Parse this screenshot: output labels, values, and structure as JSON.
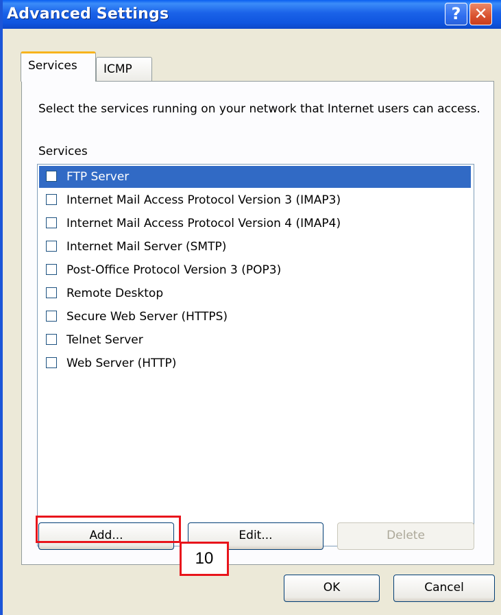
{
  "window": {
    "title": "Advanced Settings",
    "help_label": "?",
    "close_label": "✕"
  },
  "tabs": [
    {
      "label": "Services",
      "active": true
    },
    {
      "label": "ICMP",
      "active": false
    }
  ],
  "services_panel": {
    "description": "Select the services running on your network that Internet users can access.",
    "list_label": "Services",
    "items": [
      {
        "label": "FTP Server",
        "checked": false,
        "selected": true
      },
      {
        "label": "Internet Mail Access Protocol Version 3 (IMAP3)",
        "checked": false,
        "selected": false
      },
      {
        "label": "Internet Mail Access Protocol Version 4 (IMAP4)",
        "checked": false,
        "selected": false
      },
      {
        "label": "Internet Mail Server (SMTP)",
        "checked": false,
        "selected": false
      },
      {
        "label": "Post-Office Protocol Version 3 (POP3)",
        "checked": false,
        "selected": false
      },
      {
        "label": "Remote Desktop",
        "checked": false,
        "selected": false
      },
      {
        "label": "Secure Web Server (HTTPS)",
        "checked": false,
        "selected": false
      },
      {
        "label": "Telnet Server",
        "checked": false,
        "selected": false
      },
      {
        "label": "Web Server (HTTP)",
        "checked": false,
        "selected": false
      }
    ]
  },
  "buttons": {
    "add": "Add...",
    "edit": "Edit...",
    "delete": "Delete",
    "ok": "OK",
    "cancel": "Cancel"
  },
  "annotation": {
    "step_number": "10",
    "color": "#e8141b"
  },
  "colors": {
    "title_bar": "#1a62e8",
    "selection": "#316ac5",
    "active_tab_accent": "#f7b31c"
  }
}
